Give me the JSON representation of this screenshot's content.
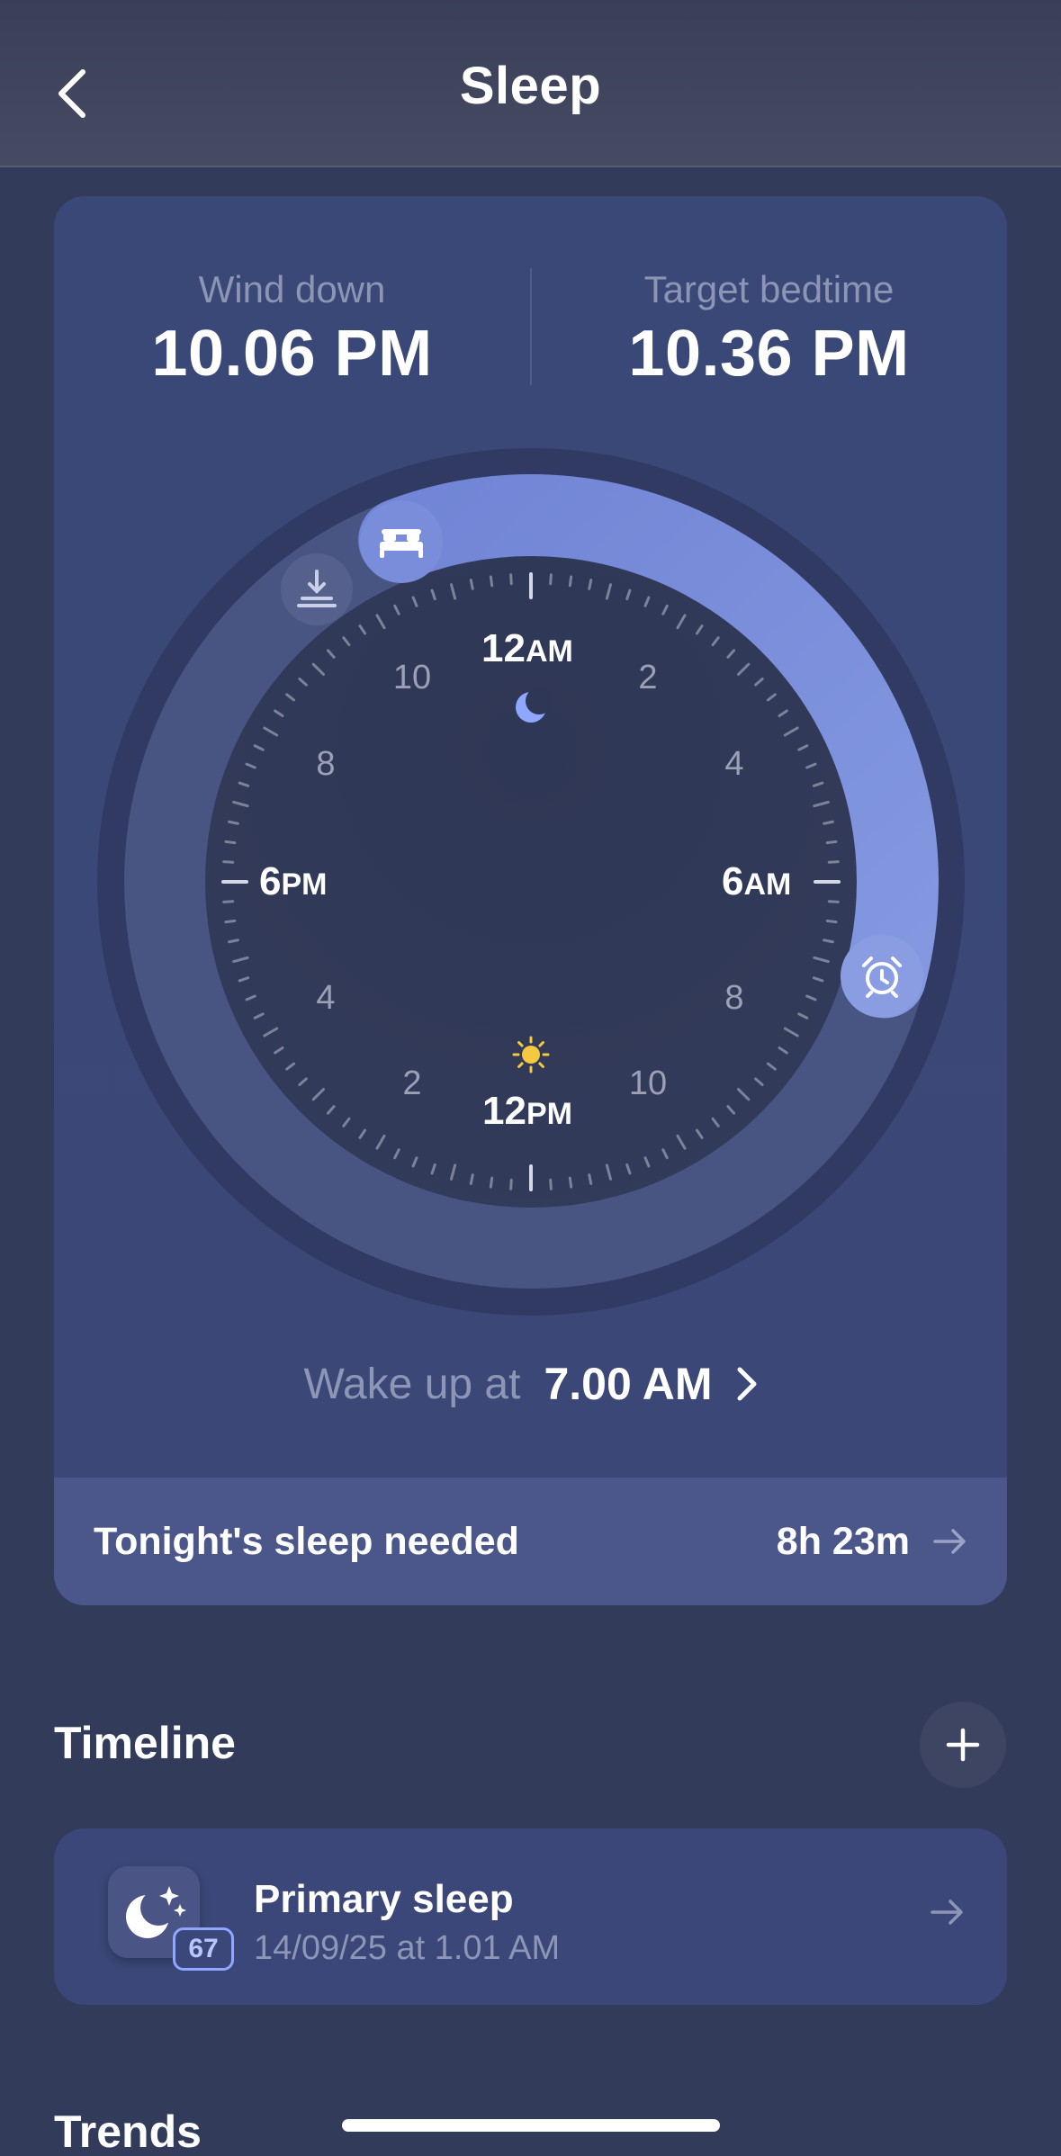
{
  "header": {
    "title": "Sleep"
  },
  "schedule": {
    "wind_down_label": "Wind down",
    "wind_down_time": "10.06 PM",
    "bedtime_label": "Target bedtime",
    "bedtime_time": "10.36 PM"
  },
  "dial": {
    "top_label_num": "12",
    "top_label_suffix": "AM",
    "right_label_num": "6",
    "right_label_suffix": "AM",
    "bottom_label_num": "12",
    "bottom_label_suffix": "PM",
    "left_label_num": "6",
    "left_label_suffix": "PM",
    "hour_numbers": [
      "2",
      "4",
      "8",
      "10",
      "2",
      "4",
      "8",
      "10"
    ],
    "sleep_start": "10.36 PM",
    "sleep_end": "7.00 AM",
    "accent_color": "#7d8fdc"
  },
  "wake": {
    "label": "Wake up at",
    "time": "7.00 AM"
  },
  "sleep_needed": {
    "label": "Tonight's sleep needed",
    "value": "8h 23m"
  },
  "timeline": {
    "title": "Timeline",
    "item": {
      "title": "Primary sleep",
      "subtitle": "14/09/25 at 1.01 AM",
      "badge": "67"
    }
  },
  "trends": {
    "title": "Trends"
  }
}
